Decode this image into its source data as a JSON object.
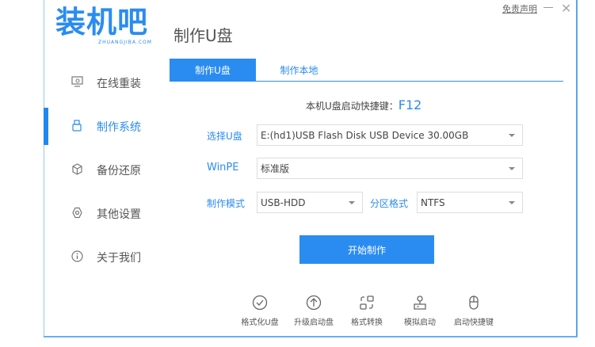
{
  "app": {
    "logo_text": "装机吧",
    "logo_sub": "ZHUANGJIBA.COM",
    "title": "制作U盘",
    "disclaimer": "免责声明",
    "close": "✕"
  },
  "sidebar": {
    "items": [
      {
        "label": "在线重装",
        "icon": "monitor-icon",
        "active": false
      },
      {
        "label": "制作系统",
        "icon": "usb-icon",
        "active": true
      },
      {
        "label": "备份还原",
        "icon": "cube-icon",
        "active": false
      },
      {
        "label": "其他设置",
        "icon": "gear-icon",
        "active": false
      },
      {
        "label": "关于我们",
        "icon": "info-icon",
        "active": false
      }
    ]
  },
  "tabs": [
    {
      "label": "制作U盘",
      "active": true
    },
    {
      "label": "制作本地",
      "active": false
    }
  ],
  "hotkey": {
    "label": "本机U盘启动快捷键：",
    "value": "F12"
  },
  "form": {
    "usb": {
      "label": "选择U盘",
      "value": "E:(hd1)USB Flash Disk USB Device 30.00GB"
    },
    "winpe": {
      "label": "WinPE",
      "value": "标准版"
    },
    "mode": {
      "label": "制作模式",
      "value": "USB-HDD"
    },
    "partition": {
      "label": "分区格式",
      "value": "NTFS"
    }
  },
  "start_button": "开始制作",
  "tools": [
    {
      "label": "格式化U盘",
      "icon": "check-circle-icon"
    },
    {
      "label": "升级启动盘",
      "icon": "arrow-up-circle-icon"
    },
    {
      "label": "格式转换",
      "icon": "convert-icon"
    },
    {
      "label": "模拟启动",
      "icon": "stamp-icon"
    },
    {
      "label": "启动快捷键",
      "icon": "mouse-icon"
    }
  ],
  "colors": {
    "accent": "#2a8cf0"
  }
}
